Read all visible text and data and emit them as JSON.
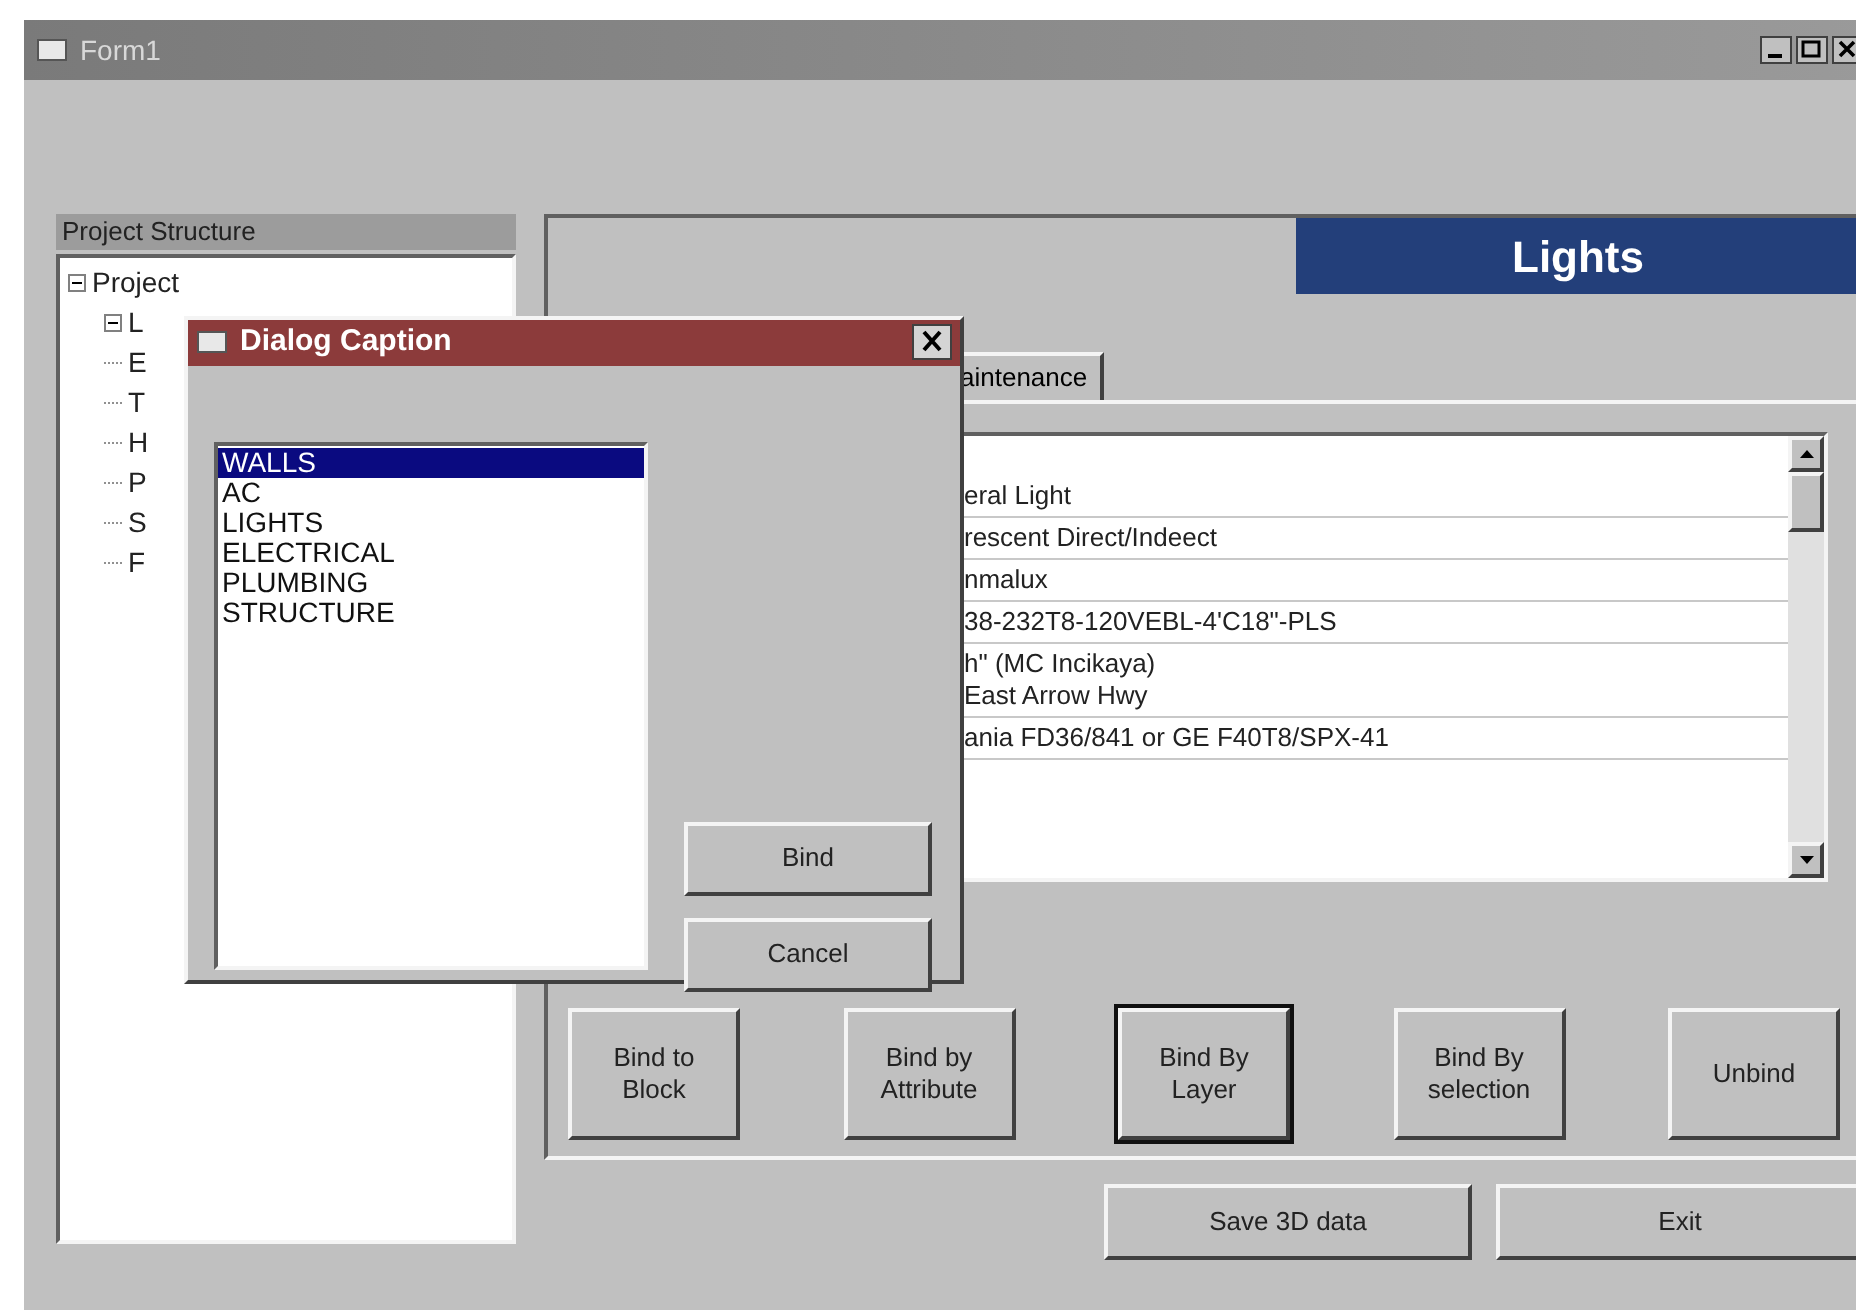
{
  "window": {
    "title": "Form1"
  },
  "project_structure": {
    "title": "Project Structure",
    "tree": [
      {
        "label": "Project",
        "expanded": true,
        "children": [
          {
            "label": "L",
            "expanded": true
          },
          {
            "label": "E"
          },
          {
            "label": "T"
          },
          {
            "label": "H"
          },
          {
            "label": "P"
          },
          {
            "label": "S"
          },
          {
            "label": "F"
          }
        ]
      }
    ]
  },
  "panel": {
    "title": "Lights",
    "tabs": [
      {
        "label": "aintenance",
        "selected": true
      }
    ],
    "grid_rows": [
      {
        "lines": [
          "eral Light"
        ]
      },
      {
        "lines": [
          "rescent Direct/Indeect"
        ]
      },
      {
        "lines": [
          "nmalux"
        ]
      },
      {
        "lines": [
          "38-232T8-120VEBL-4'C18\"-PLS"
        ]
      },
      {
        "lines": [
          "h\" (MC Incikaya)",
          "East Arrow Hwy"
        ]
      },
      {
        "lines": [
          "ania FD36/841 or GE F40T8/SPX-41"
        ]
      }
    ],
    "bind_buttons": [
      {
        "label": "Bind to Block",
        "default": false
      },
      {
        "label": "Bind by Attribute",
        "default": false
      },
      {
        "label": "Bind By Layer",
        "default": true
      },
      {
        "label": "Bind By selection",
        "default": false
      },
      {
        "label": "Unbind",
        "default": false
      }
    ]
  },
  "footer_buttons": [
    "Save 3D data",
    "Exit"
  ],
  "dialog": {
    "title": "Dialog Caption",
    "items": [
      {
        "label": "WALLS",
        "selected": true
      },
      {
        "label": "AC",
        "selected": false
      },
      {
        "label": "LIGHTS",
        "selected": false
      },
      {
        "label": "ELECTRICAL",
        "selected": false
      },
      {
        "label": "PLUMBING",
        "selected": false
      },
      {
        "label": "STRUCTURE",
        "selected": false
      }
    ],
    "buttons": [
      "Bind",
      "Cancel"
    ]
  }
}
